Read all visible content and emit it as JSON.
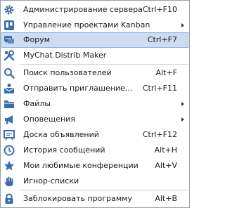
{
  "menu": {
    "items": [
      {
        "label": "Администрирование сервера",
        "shortcut": "Ctrl+F10"
      },
      {
        "label": "Управление проектами Kanban",
        "shortcut": ""
      },
      {
        "label": "Форум",
        "shortcut": "Ctrl+F7"
      },
      {
        "label": "MyChat Distrib Maker",
        "shortcut": ""
      },
      {
        "label": "Поиск пользователей",
        "shortcut": "Alt+F"
      },
      {
        "label": "Отправить приглашение...",
        "shortcut": "Ctrl+F11"
      },
      {
        "label": "Файлы",
        "shortcut": ""
      },
      {
        "label": "Оповещения",
        "shortcut": ""
      },
      {
        "label": "Доска объявлений",
        "shortcut": "Ctrl+F12"
      },
      {
        "label": "История сообщений",
        "shortcut": "Alt+H"
      },
      {
        "label": "Мои любимые конференции",
        "shortcut": "Alt+V"
      },
      {
        "label": "Игнор-списки",
        "shortcut": ""
      },
      {
        "label": "Заблокировать программу",
        "shortcut": "Alt+B"
      }
    ]
  },
  "icons": {
    "server_admin": "gear-icon",
    "kanban": "kanban-board-icon",
    "forum": "forum-chat-icon",
    "distrib_maker": "tools-icon",
    "search_users": "magnifier-icon",
    "invite": "envelope-person-icon",
    "files": "folder-icon",
    "notifications": "megaphone-icon",
    "board": "board-icon",
    "history": "clock-icon",
    "favorites": "star-icon",
    "ignore": "hand-icon",
    "lock": "lock-icon"
  },
  "colors": {
    "icon": "#3b6ea8",
    "highlight_bg": "#cddcf1",
    "highlight_border": "#8fb0dc"
  }
}
